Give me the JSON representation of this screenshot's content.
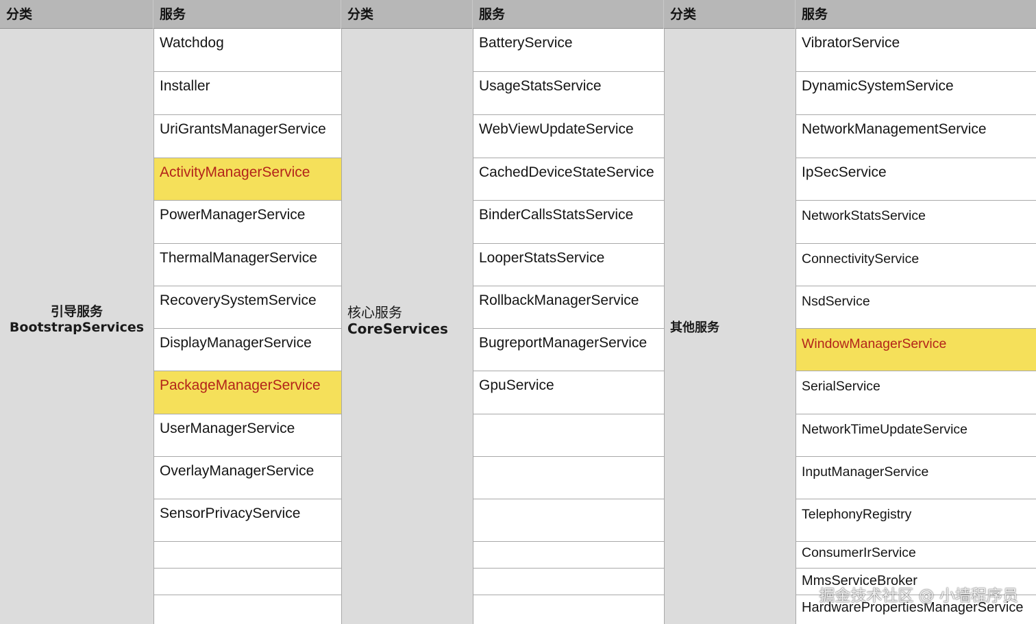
{
  "headers": [
    "分类",
    "服务",
    "分类",
    "服务",
    "分类",
    "服务"
  ],
  "groups": [
    {
      "category": "引导服务",
      "category_en": "BootstrapServices",
      "services": [
        {
          "name": "Watchdog",
          "highlight": false
        },
        {
          "name": "Installer",
          "highlight": false
        },
        {
          "name": "UriGrantsManagerService",
          "highlight": false
        },
        {
          "name": "ActivityManagerService",
          "highlight": true
        },
        {
          "name": "PowerManagerService",
          "highlight": false
        },
        {
          "name": "ThermalManagerService",
          "highlight": false
        },
        {
          "name": "RecoverySystemService",
          "highlight": false
        },
        {
          "name": "DisplayManagerService",
          "highlight": false
        },
        {
          "name": "PackageManagerService",
          "highlight": true
        },
        {
          "name": "UserManagerService",
          "highlight": false
        },
        {
          "name": "OverlayManagerService",
          "highlight": false
        },
        {
          "name": "SensorPrivacyService",
          "highlight": false
        },
        {
          "name": "",
          "highlight": false
        },
        {
          "name": "",
          "highlight": false
        },
        {
          "name": "",
          "highlight": false
        }
      ]
    },
    {
      "category": "核心服务",
      "category_en": "CoreServices",
      "services": [
        {
          "name": "BatteryService",
          "highlight": false
        },
        {
          "name": "UsageStatsService",
          "highlight": false
        },
        {
          "name": "WebViewUpdateService",
          "highlight": false
        },
        {
          "name": "CachedDeviceStateService",
          "highlight": false
        },
        {
          "name": "BinderCallsStatsService",
          "highlight": false
        },
        {
          "name": "LooperStatsService",
          "highlight": false
        },
        {
          "name": "RollbackManagerService",
          "highlight": false
        },
        {
          "name": "BugreportManagerService",
          "highlight": false
        },
        {
          "name": "GpuService",
          "highlight": false
        },
        {
          "name": "",
          "highlight": false
        },
        {
          "name": "",
          "highlight": false
        },
        {
          "name": "",
          "highlight": false
        },
        {
          "name": "",
          "highlight": false
        },
        {
          "name": "",
          "highlight": false
        },
        {
          "name": "",
          "highlight": false
        }
      ]
    },
    {
      "category": "其他服务",
      "category_en": "",
      "services": [
        {
          "name": "VibratorService",
          "highlight": false
        },
        {
          "name": "DynamicSystemService",
          "highlight": false
        },
        {
          "name": "NetworkManagementService",
          "highlight": false
        },
        {
          "name": "IpSecService",
          "highlight": false
        },
        {
          "name": "NetworkStatsService",
          "highlight": false
        },
        {
          "name": "ConnectivityService",
          "highlight": false
        },
        {
          "name": "NsdService",
          "highlight": false
        },
        {
          "name": "WindowManagerService",
          "highlight": true
        },
        {
          "name": "SerialService",
          "highlight": false
        },
        {
          "name": "NetworkTimeUpdateService",
          "highlight": false
        },
        {
          "name": "InputManagerService",
          "highlight": false
        },
        {
          "name": "TelephonyRegistry",
          "highlight": false
        },
        {
          "name": "ConsumerIrService",
          "highlight": false
        },
        {
          "name": "MmsServiceBroker",
          "highlight": false
        },
        {
          "name": "HardwarePropertiesManagerService",
          "highlight": false
        }
      ]
    }
  ],
  "watermark": "掘金技术社区 @ 小墙程序员",
  "colors": {
    "header_bg": "#b7b7b7",
    "category_bg": "#dcdcdc",
    "highlight_bg": "#f5e05a",
    "highlight_text": "#b3241a"
  }
}
